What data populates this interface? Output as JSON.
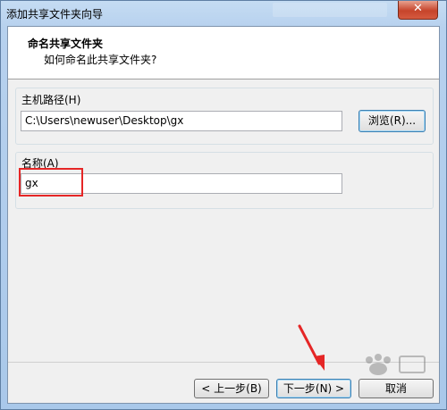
{
  "window": {
    "title": "添加共享文件夹向导",
    "close_label": "✕"
  },
  "header": {
    "title": "命名共享文件夹",
    "subtitle": "如何命名此共享文件夹?"
  },
  "host_path": {
    "label": "主机路径(H)",
    "value": "C:\\Users\\newuser\\Desktop\\gx",
    "browse_label": "浏览(R)..."
  },
  "name": {
    "label": "名称(A)",
    "value": "gx"
  },
  "footer": {
    "back_label": "< 上一步(B)",
    "next_label": "下一步(N) >",
    "cancel_label": "取消"
  },
  "annotations": {
    "highlight_color": "#e52626",
    "arrow_color": "#e52626"
  }
}
